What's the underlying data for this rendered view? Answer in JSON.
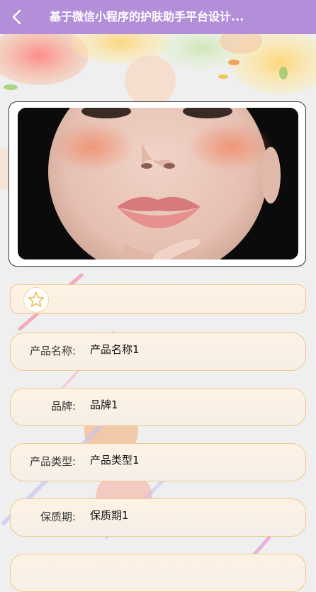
{
  "header": {
    "title": "基于微信小程序的护肤助手平台设计...",
    "back_icon": "chevron-left-icon",
    "bg_color": "#b48fd9"
  },
  "product": {
    "image_alt": "product photo: model face with pink lips",
    "favorite_icon": "star-outline-icon"
  },
  "fields": [
    {
      "label": "产品名称:",
      "value": "产品名称1"
    },
    {
      "label": "品牌:",
      "value": "品牌1"
    },
    {
      "label": "产品类型:",
      "value": "产品类型1"
    },
    {
      "label": "保质期:",
      "value": "保质期1"
    }
  ],
  "colors": {
    "accent": "#b48fd9",
    "field_border": "#f0c98a",
    "star": "#f0c060"
  }
}
